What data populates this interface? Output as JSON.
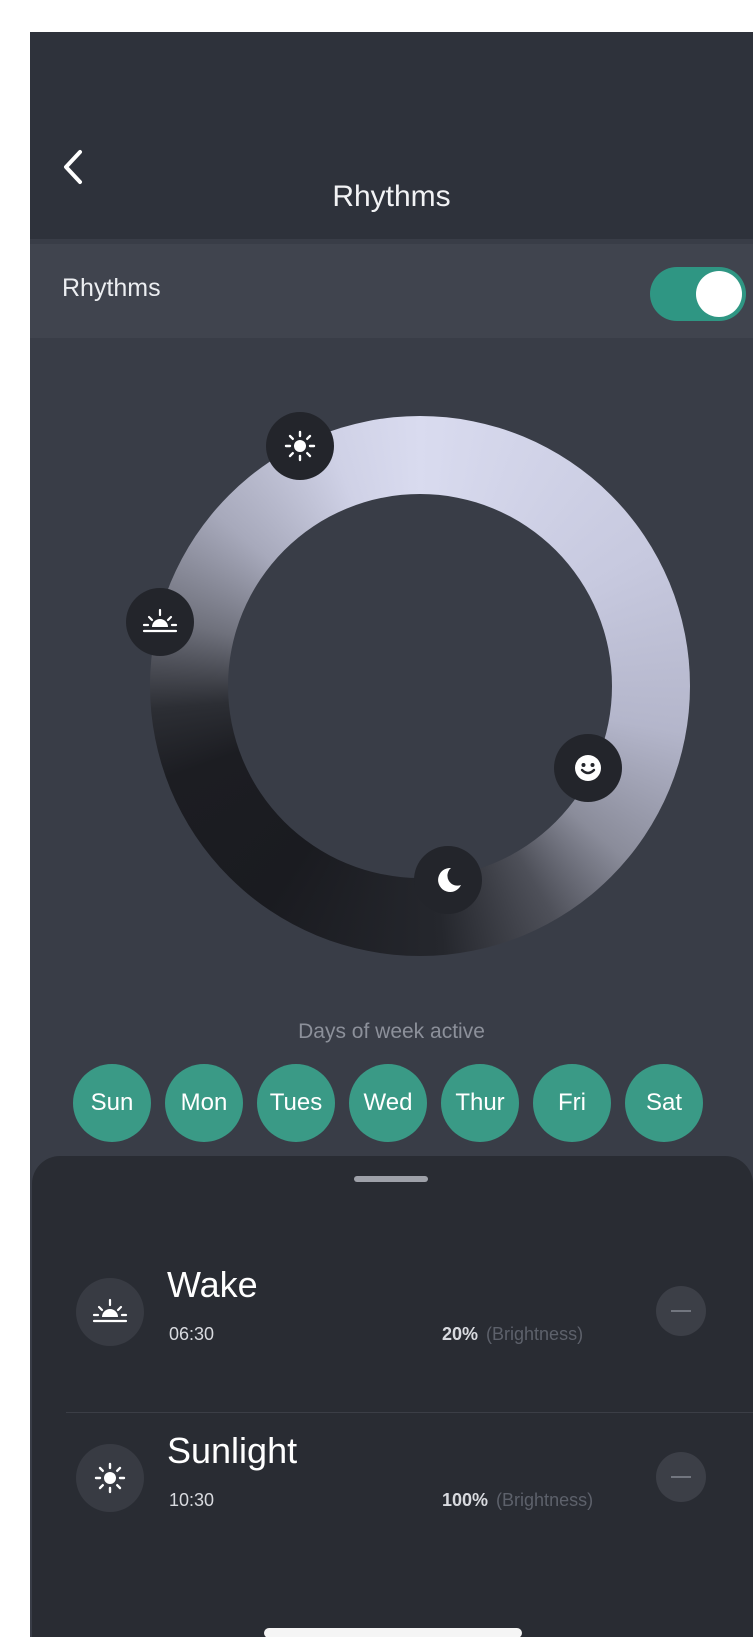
{
  "header": {
    "title": "Rhythms",
    "back_icon": "chevron-left-icon"
  },
  "toggle_row": {
    "label": "Rhythms",
    "enabled": true,
    "accent": "#2f9683"
  },
  "dial": {
    "markers": [
      {
        "name": "sun-marker",
        "icon": "sun-icon"
      },
      {
        "name": "sunrise-marker",
        "icon": "sunrise-icon"
      },
      {
        "name": "smile-marker",
        "icon": "smile-icon"
      },
      {
        "name": "moon-marker",
        "icon": "moon-icon"
      }
    ]
  },
  "days": {
    "caption": "Days of week active",
    "items": [
      "Sun",
      "Mon",
      "Tues",
      "Wed",
      "Thur",
      "Fri",
      "Sat"
    ],
    "active_color": "#3a9a86"
  },
  "schedule": [
    {
      "name": "Wake",
      "time": "06:30",
      "brightness": "20%",
      "brightness_label": "(Brightness)",
      "icon": "sunrise-icon"
    },
    {
      "name": "Sunlight",
      "time": "10:30",
      "brightness": "100%",
      "brightness_label": "(Brightness)",
      "icon": "sun-icon"
    }
  ]
}
